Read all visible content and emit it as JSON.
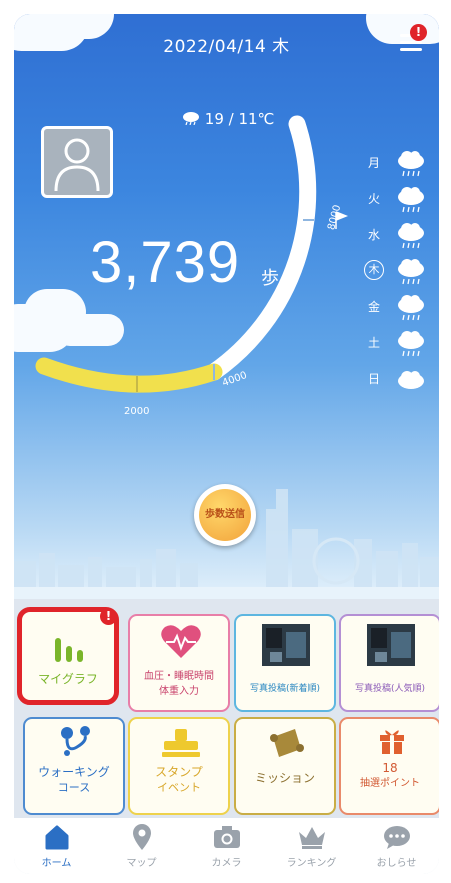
{
  "header": {
    "date": "2022/04/14 木",
    "menu_badge": "!"
  },
  "weather": {
    "temps": "19 / 11℃"
  },
  "steps": {
    "count": "3,739",
    "unit": "歩",
    "ring_labels": {
      "goal": "8000",
      "mark_4000": "4000",
      "mark_2000": "2000"
    }
  },
  "week_forecast": [
    {
      "day": "月",
      "icon": "rain-cloud-icon"
    },
    {
      "day": "火",
      "icon": "rain-cloud-icon"
    },
    {
      "day": "水",
      "icon": "rain-cloud-icon"
    },
    {
      "day": "木",
      "icon": "rain-cloud-icon",
      "today": true
    },
    {
      "day": "金",
      "icon": "rain-cloud-icon"
    },
    {
      "day": "土",
      "icon": "rain-cloud-icon"
    },
    {
      "day": "日",
      "icon": "cloud-icon"
    }
  ],
  "send_button": {
    "label": "歩数送信"
  },
  "tiles": {
    "my_graph": {
      "label": "マイグラフ",
      "badge": "!"
    },
    "vitals": {
      "line1": "血圧・睡眠時間",
      "line2": "体重入力"
    },
    "photo_new": {
      "label": "写真投稿(新着順)"
    },
    "photo_popular": {
      "label": "写真投稿(人気順)"
    },
    "walking": {
      "line1": "ウォーキング",
      "line2": "コース"
    },
    "stamp": {
      "line1": "スタンプ",
      "line2": "イベント"
    },
    "mission": {
      "label": "ミッション"
    },
    "lottery": {
      "line1": "18",
      "line2": "抽選ポイント"
    }
  },
  "tabs": {
    "home": "ホーム",
    "map": "マップ",
    "camera": "カメラ",
    "ranking": "ランキング",
    "news": "おしらせ"
  },
  "colors": {
    "accent": "#2b6fc4",
    "graph_green": "#7ab52a",
    "highlight_red": "#e0242a",
    "ring_yellow": "#f1e04d"
  }
}
